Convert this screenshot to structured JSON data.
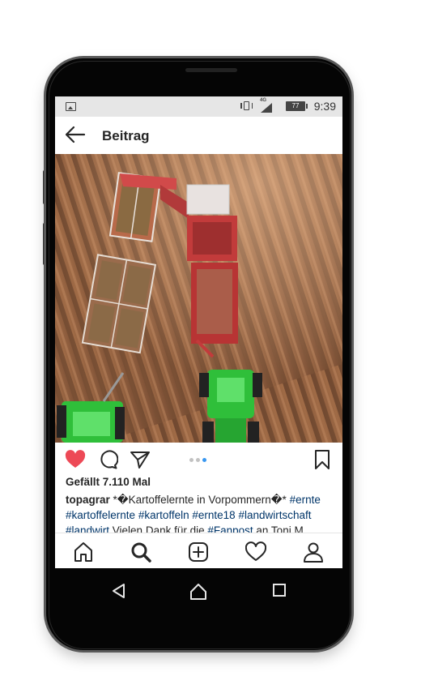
{
  "statusbar": {
    "network": "4G",
    "battery": "77",
    "time": "9:39"
  },
  "header": {
    "title": "Beitrag"
  },
  "post": {
    "likes": "Gefällt 7.110 Mal",
    "caption_user": "topagrar",
    "caption_text_1": " *�Kartoffelernte in Vorpommern�* ",
    "tag_1": "#ernte",
    "tag_2": "#kartoffelernte",
    "tag_3": "#kartoffeln",
    "tag_4": "#ernte18",
    "tag_5": "#landwirtschaft",
    "tag_6": "#landwirt",
    "caption_text_2": " Vielen Dank für die ",
    "tag_7": "#Fanpost",
    "caption_text_3": " an Toni M"
  },
  "colors": {
    "like_red": "#ed4956",
    "hashtag_blue": "#003569",
    "carousel_active": "#3897f0"
  },
  "icons": {
    "back": "arrow-left-icon",
    "like": "heart-icon",
    "comment": "comment-icon",
    "share": "paper-plane-icon",
    "save": "bookmark-icon",
    "home": "home-icon",
    "search": "search-icon",
    "add": "plus-square-icon",
    "activity": "heart-outline-icon",
    "profile": "profile-icon"
  }
}
